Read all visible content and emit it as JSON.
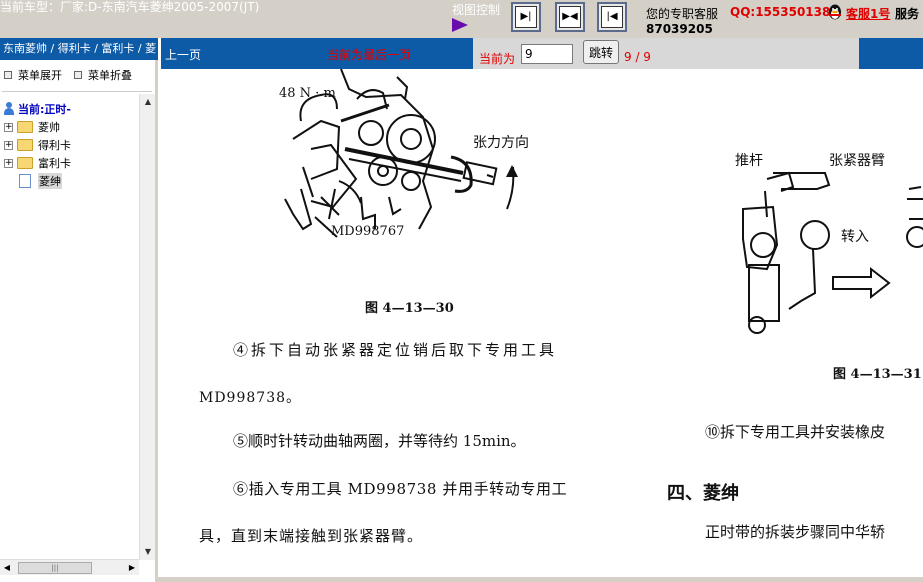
{
  "header": {
    "car_model": "当前车型：厂家:D-东南汽车菱绅2005-2007(JT)",
    "view_control_label": "视图控制",
    "service_label": "您的专职客服",
    "qq": "QQ:1553501388",
    "kefu_link": "客服1号",
    "service_rest": "服务",
    "phone": "87039205"
  },
  "sidebar": {
    "breadcrumb": "东南菱帅 / 得利卡 / 富利卡 / 菱",
    "expand_label": "菜单展开",
    "collapse_label": "菜单折叠",
    "current_label": "当前:正时-",
    "items": [
      {
        "label": "菱帅",
        "type": "folder",
        "toggle": "+"
      },
      {
        "label": "得利卡",
        "type": "folder",
        "toggle": "+"
      },
      {
        "label": "富利卡",
        "type": "folder",
        "toggle": "+"
      },
      {
        "label": "菱绅",
        "type": "document",
        "selected": true
      }
    ]
  },
  "toolbar": {
    "prev_page": "上一页",
    "last_page_notice": "当前为最后一页",
    "current_label": "当前为",
    "page_value": "9",
    "jump_button": "跳转",
    "page_count": "9 / 9"
  },
  "document": {
    "torque_label": "48 N · m",
    "tension_direction": "张力方向",
    "tool_label": "MD998767",
    "fig_30_caption": "图 4—13—30",
    "step_4_line1": "④拆下自动张紧器定位销后取下专用工具",
    "step_4_line2": "MD998738。",
    "step_5": "⑤顺时针转动曲轴两圈，并等待约 15min。",
    "step_6_line1": "⑥插入专用工具 MD998738 并用手转动专用工",
    "step_6_line2": "具，直到末端接触到张紧器臂。",
    "push_rod_label": "推杆",
    "tensioner_arm_label": "张紧器臂",
    "turn_in_label": "转入",
    "fig_31_caption": "图 4—13—31",
    "step_10": "⑩拆下专用工具并安装橡皮",
    "section_title": "四、菱绅",
    "section_text": "正时带的拆装步骤同中华轿"
  }
}
